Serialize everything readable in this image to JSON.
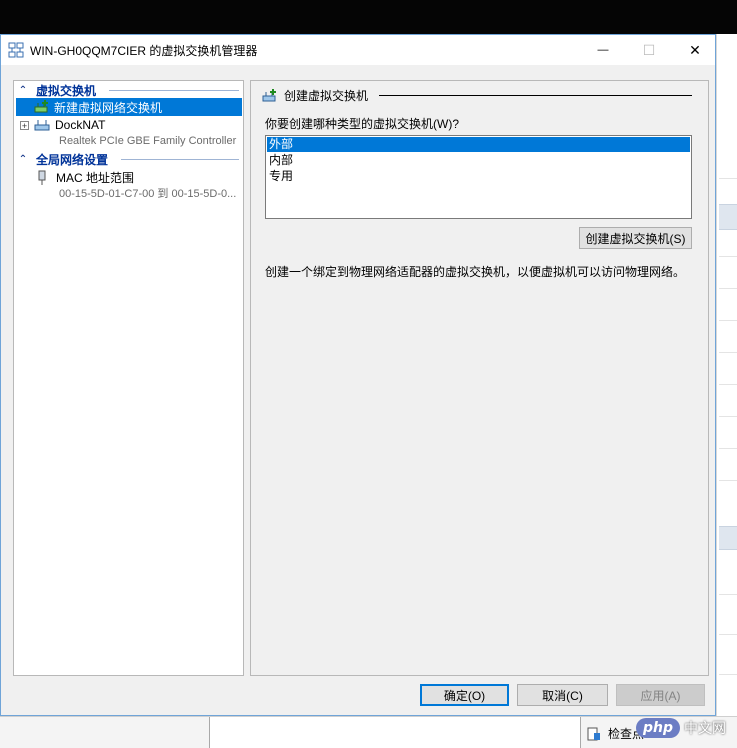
{
  "window": {
    "title": "WIN-GH0QQM7CIER 的虚拟交换机管理器"
  },
  "titlebar": {
    "minimize": "—",
    "maximize": "☐",
    "close": "✕"
  },
  "left_pane": {
    "section_switches": "虚拟交换机",
    "new_switch": "新建虚拟网络交换机",
    "switch_name": "DockNAT",
    "switch_adapter": "Realtek PCIe GBE Family Controller",
    "section_global": "全局网络设置",
    "mac_label": "MAC 地址范围",
    "mac_range": "00-15-5D-01-C7-00 到 00-15-5D-0..."
  },
  "right_pane": {
    "heading": "创建虚拟交换机",
    "question": "你要创建哪种类型的虚拟交换机(W)?",
    "types": [
      "外部",
      "内部",
      "专用"
    ],
    "selected_type": "外部",
    "create_button": "创建虚拟交换机(S)",
    "description": "创建一个绑定到物理网络适配器的虚拟交换机，以便虚拟机可以访问物理网络。"
  },
  "footer": {
    "ok": "确定(O)",
    "cancel": "取消(C)",
    "apply": "应用(A)"
  },
  "background": {
    "checkpoint": "检查点"
  },
  "watermark": {
    "logo": "php",
    "text": "中文网"
  },
  "colors": {
    "accent": "#0078d7",
    "section": "#003399",
    "window_border": "#6fa4d8"
  }
}
